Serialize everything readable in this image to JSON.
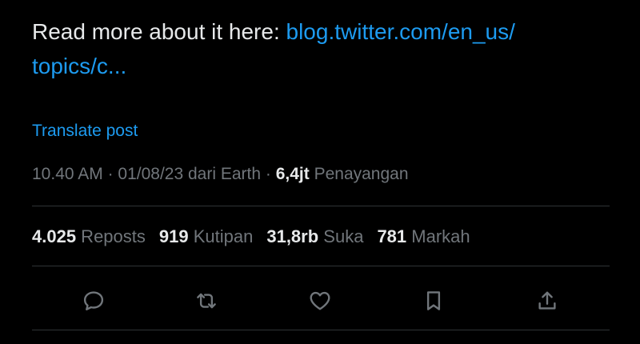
{
  "post": {
    "text": "Read more about it here: ",
    "link": "blog.twitter.com/en_us/ topics/c..."
  },
  "translate_label": "Translate post",
  "meta": {
    "time": "10.40 AM",
    "sep1": " · ",
    "date": "01/08/23",
    "source": " dari Earth",
    "sep2": " · ",
    "views_count": "6,4jt",
    "views_label": " Penayangan"
  },
  "stats": [
    {
      "count": "4.025",
      "label": " Reposts"
    },
    {
      "count": "919",
      "label": " Kutipan"
    },
    {
      "count": "31,8rb",
      "label": " Suka"
    },
    {
      "count": "781",
      "label": " Markah"
    }
  ],
  "actions": {
    "reply": "reply-icon",
    "repost": "repost-icon",
    "like": "heart-icon",
    "bookmark": "bookmark-icon",
    "share": "share-icon"
  },
  "colors": {
    "background": "#000000",
    "text": "#e7e9ea",
    "muted": "#71767b",
    "link": "#1d9bf0",
    "divider": "#2f3336"
  }
}
